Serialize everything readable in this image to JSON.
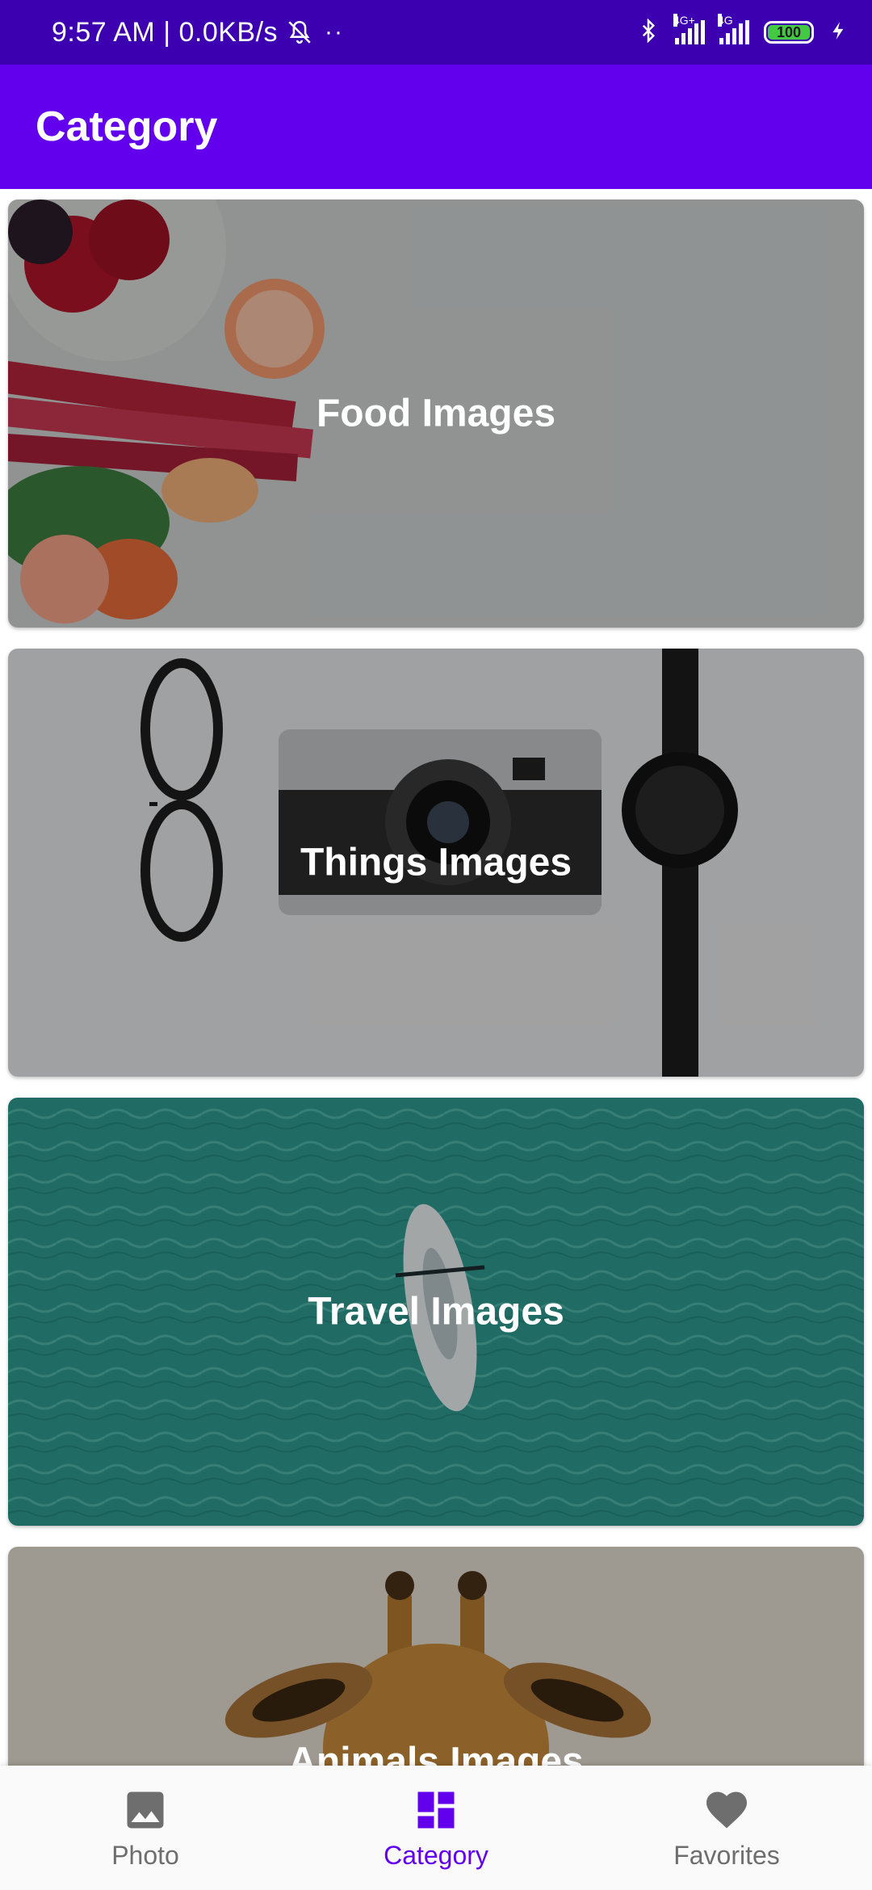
{
  "status_bar": {
    "time_speed": "9:57 AM | 0.0KB/s",
    "dots": "··",
    "sig1_label": "4G+",
    "sig2_label": "4G",
    "battery": "100"
  },
  "app_bar": {
    "title": "Category"
  },
  "categories": [
    {
      "label": "Food Images"
    },
    {
      "label": "Things Images"
    },
    {
      "label": "Travel Images"
    },
    {
      "label": "Animals Images"
    }
  ],
  "bottom_nav": {
    "items": [
      {
        "label": "Photo",
        "icon": "image-icon"
      },
      {
        "label": "Category",
        "icon": "dashboard-icon"
      },
      {
        "label": "Favorites",
        "icon": "heart-icon"
      }
    ],
    "active": "Category"
  },
  "colors": {
    "status_bar": "#3c00b0",
    "app_bar": "#6200ee",
    "active_nav": "#6200ee"
  }
}
